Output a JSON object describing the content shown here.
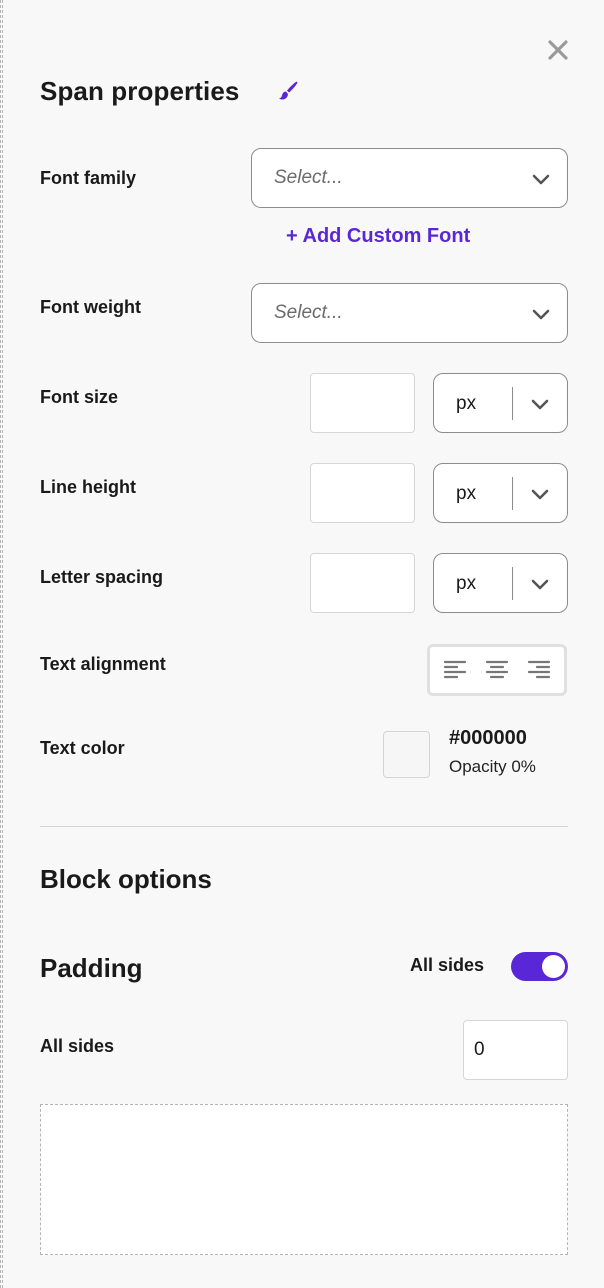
{
  "panel": {
    "title": "Span properties"
  },
  "font_family": {
    "label": "Font family",
    "placeholder": "Select...",
    "add_custom_font": "+ Add Custom Font"
  },
  "font_weight": {
    "label": "Font weight",
    "placeholder": "Select..."
  },
  "font_size": {
    "label": "Font size",
    "value": "",
    "unit": "px"
  },
  "line_height": {
    "label": "Line height",
    "value": "",
    "unit": "px"
  },
  "letter_spacing": {
    "label": "Letter spacing",
    "value": "",
    "unit": "px"
  },
  "text_alignment": {
    "label": "Text alignment",
    "options": [
      "left",
      "center",
      "right"
    ]
  },
  "text_color": {
    "label": "Text color",
    "hex": "#000000",
    "opacity": "Opacity 0%"
  },
  "block_options": {
    "title": "Block options"
  },
  "padding": {
    "title": "Padding",
    "toggle_label": "All sides",
    "toggle_on": true,
    "all_sides_label": "All sides",
    "all_sides_value": "0"
  },
  "colors": {
    "accent": "#5a27d6",
    "background": "#f8f8f8"
  },
  "icons": {
    "close": "close-icon",
    "brush": "paintbrush-icon",
    "chevron": "chevron-down-icon",
    "align_left": "align-left-icon",
    "align_center": "align-center-icon",
    "align_right": "align-right-icon"
  }
}
